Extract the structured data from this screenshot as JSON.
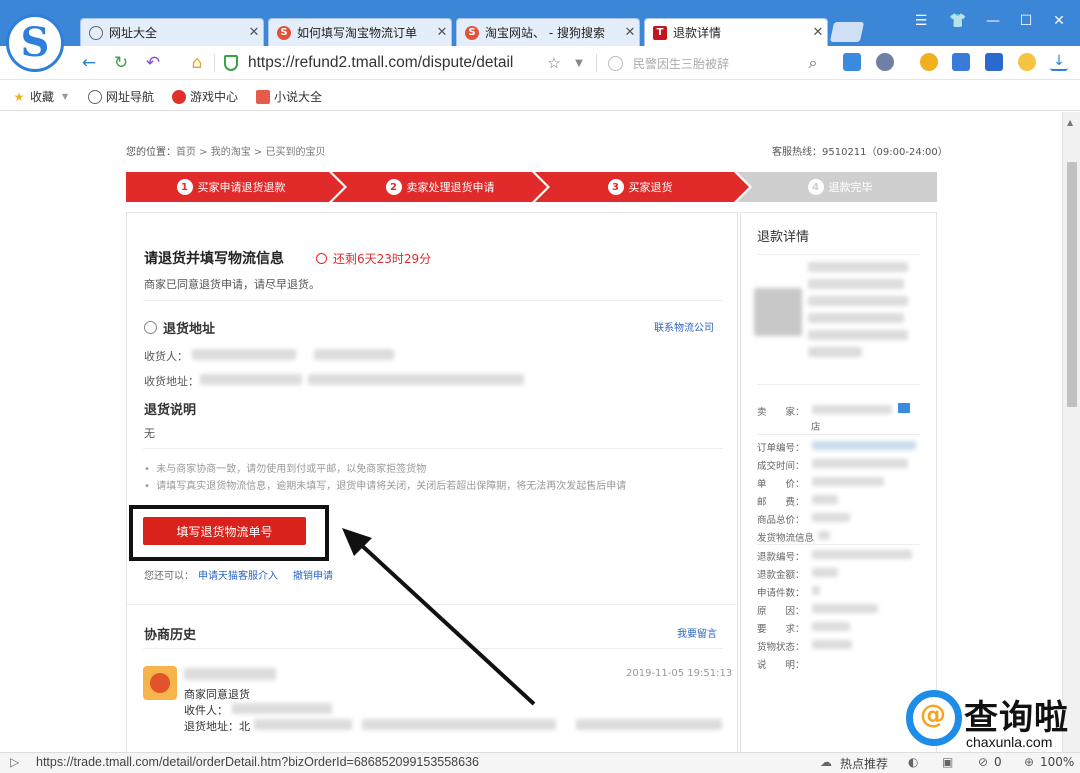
{
  "browser": {
    "tabs": [
      {
        "label": "网址大全",
        "icon": "globe-icon"
      },
      {
        "label": "如何填写淘宝物流订单",
        "icon": "sogou-icon"
      },
      {
        "label": "淘宝网站、 - 搜狗搜索",
        "icon": "sogou-icon"
      },
      {
        "label": "退款详情",
        "icon": "tmall-icon"
      }
    ],
    "url": "https://refund2.tmall.com/dispute/detail",
    "search_placeholder": "民警因生三胎被辞",
    "bookmarks": [
      {
        "label": "收藏",
        "icon": "star-icon"
      },
      {
        "label": "网址导航",
        "icon": "globe-icon"
      },
      {
        "label": "游戏中心",
        "icon": "game-icon"
      },
      {
        "label": "小说大全",
        "icon": "book-icon"
      }
    ],
    "status_url": "https://trade.tmall.com/detail/orderDetail.htm?bizOrderId=686852099153558636",
    "status_hot": "热点推荐",
    "status_count": "0",
    "status_zoom": "100%"
  },
  "page": {
    "breadcrumb_prefix": "您的位置：",
    "breadcrumb": "首页 > 我的淘宝 > 已买到的宝贝",
    "hotline": "客服热线：9510211（09:00-24:00）",
    "steps": [
      {
        "num": "1",
        "label": "买家申请退货退款"
      },
      {
        "num": "2",
        "label": "卖家处理退货申请"
      },
      {
        "num": "3",
        "label": "买家退货"
      },
      {
        "num": "4",
        "label": "退款完毕"
      }
    ],
    "heading": "请退货并填写物流信息",
    "countdown": "还剩6天23时29分",
    "agreed_text": "商家已同意退货申请，请尽早退货。",
    "return_addr_title": "退货地址",
    "contact_link": "联系物流公司",
    "receiver_label": "收货人：",
    "address_label": "收货地址：",
    "return_note_title": "退货说明",
    "return_note_value": "无",
    "notes": [
      "未与商家协商一致，请勿使用到付或平邮，以免商家拒签货物",
      "请填写真实退货物流信息，逾期未填写，退货申请将关闭，关闭后若超出保障期，将无法再次发起售后申请"
    ],
    "fill_button": "填写退货物流单号",
    "also_label": "您还可以：",
    "link_tmall_service": "申请天猫客服介入",
    "link_cancel": "撤销申请",
    "history_title": "协商历史",
    "leave_message": "我要留言",
    "history_time": "2019-11-05 19:51:13",
    "history_lines": [
      "商家同意退货",
      "收件人：",
      "退货地址：北"
    ],
    "side_title": "退款详情",
    "side_labels": [
      "卖　　家：",
      "订单编号：",
      "成交时间：",
      "单　　价：",
      "邮　　费：",
      "商品总价：",
      "发货物流信息",
      "退款编号：",
      "退款金额：",
      "申请件数：",
      "原　　因：",
      "要　　求：",
      "货物状态：",
      "说　　明："
    ],
    "side_seller_suffix": "店"
  },
  "watermark": {
    "big": "查询啦",
    "small": "chaxunla.com"
  },
  "colors": {
    "step_red": "#e12b2b",
    "step_gray": "#cfcfcf",
    "button_red": "#d9221c",
    "link_blue": "#2a66c4",
    "browser_blue": "#3c86d8"
  }
}
